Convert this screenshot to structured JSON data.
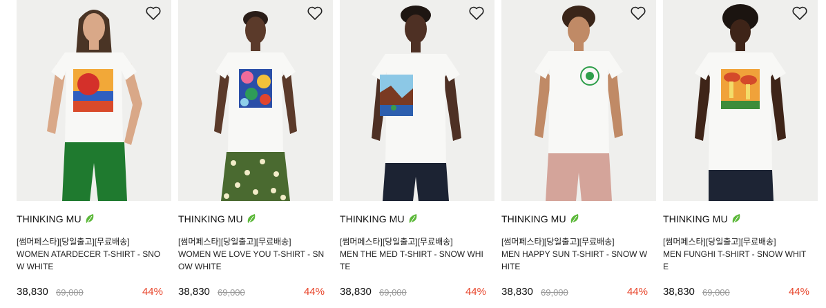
{
  "products": [
    {
      "brand": "THINKING MU",
      "tag": "[썸머페스타][당일출고][무료배송]",
      "name": "WOMEN ATARDECER T-SHIRT - SNOW WHITE",
      "price": "38,830",
      "original_price": "69,000",
      "discount": "44%"
    },
    {
      "brand": "THINKING MU",
      "tag": "[썸머페스타][당일출고][무료배송]",
      "name": "WOMEN WE LOVE YOU T-SHIRT - SNOW WHITE",
      "price": "38,830",
      "original_price": "69,000",
      "discount": "44%"
    },
    {
      "brand": "THINKING MU",
      "tag": "[썸머페스타][당일출고][무료배송]",
      "name": "MEN THE MED T-SHIRT - SNOW WHITE",
      "price": "38,830",
      "original_price": "69,000",
      "discount": "44%"
    },
    {
      "brand": "THINKING MU",
      "tag": "[썸머페스타][당일출고][무료배송]",
      "name": "MEN HAPPY SUN T-SHIRT - SNOW WHITE",
      "price": "38,830",
      "original_price": "69,000",
      "discount": "44%"
    },
    {
      "brand": "THINKING MU",
      "tag": "[썸머페스타][당일출고][무료배송]",
      "name": "MEN FUNGHI T-SHIRT - SNOW WHITE",
      "price": "38,830",
      "original_price": "69,000",
      "discount": "44%"
    }
  ],
  "colors": {
    "discount": "#e8462c",
    "leaf": "#5cb83a",
    "strike": "#9a9a9a"
  },
  "icons": {
    "wishlist": "heart-outline-icon",
    "eco": "leaf-icon"
  }
}
